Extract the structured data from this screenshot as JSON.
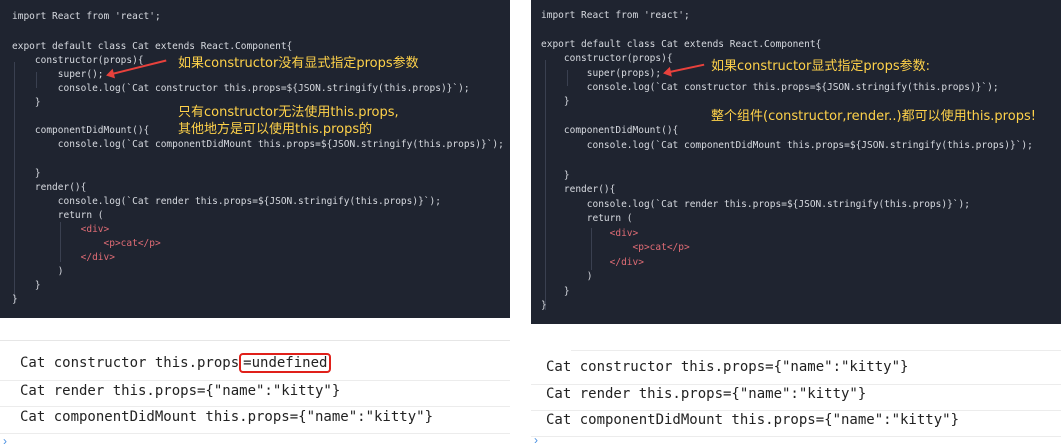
{
  "left": {
    "code": [
      "import React from 'react';",
      "",
      "export default class Cat extends React.Component{",
      "    constructor(props){",
      "        super();",
      "        console.log(`Cat constructor this.props=${JSON.stringify(this.props)}`);",
      "    }",
      "",
      "    componentDidMount(){",
      "        console.log(`Cat componentDidMount this.props=${JSON.stringify(this.props)}`);",
      "",
      "    }",
      "    render(){",
      "        console.log(`Cat render this.props=${JSON.stringify(this.props)}`);",
      "        return (",
      "            <div>",
      "                <p>cat</p>",
      "            </div>",
      "        )",
      "    }",
      "}"
    ],
    "note1": "如果constructor没有显式指定props参数",
    "note2a": "只有constructor无法使用this.props,",
    "note2b": "其他地方是可以使用this.props的",
    "console": {
      "line1_prefix": "Cat constructor this.props",
      "line1_highlight": "=undefined",
      "line2": "Cat render this.props={\"name\":\"kitty\"}",
      "line3": "Cat componentDidMount this.props={\"name\":\"kitty\"}"
    }
  },
  "right": {
    "code": [
      "import React from 'react';",
      "",
      "export default class Cat extends React.Component{",
      "    constructor(props){",
      "        super(props);",
      "        console.log(`Cat constructor this.props=${JSON.stringify(this.props)}`);",
      "    }",
      "",
      "    componentDidMount(){",
      "        console.log(`Cat componentDidMount this.props=${JSON.stringify(this.props)}`);",
      "",
      "    }",
      "    render(){",
      "        console.log(`Cat render this.props=${JSON.stringify(this.props)}`);",
      "        return (",
      "            <div>",
      "                <p>cat</p>",
      "            </div>",
      "        )",
      "    }",
      "}"
    ],
    "note1": "如果constructor显式指定props参数:",
    "note2": "整个组件(constructor,render..)都可以使用this.props!",
    "console": {
      "line1": "Cat constructor this.props={\"name\":\"kitty\"}",
      "line2": "Cat render this.props={\"name\":\"kitty\"}",
      "line3": "Cat componentDidMount this.props={\"name\":\"kitty\"}"
    }
  }
}
